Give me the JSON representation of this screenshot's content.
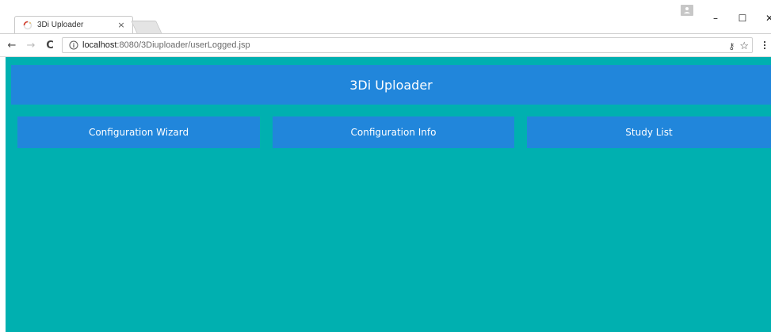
{
  "browser": {
    "tab_title": "3Di Uploader",
    "tab_close": "×",
    "url_host": "localhost",
    "url_path": ":8080/3Diuploader/userLogged.jsp",
    "nav_back": "←",
    "nav_forward": "→",
    "nav_reload": "C",
    "window_minimize": "–",
    "window_maximize": "☐",
    "window_close": "✕",
    "star": "☆",
    "key": "⚷"
  },
  "page": {
    "header_title": "3Di Uploader",
    "nav": [
      {
        "label": "Configuration Wizard"
      },
      {
        "label": "Configuration Info"
      },
      {
        "label": "Study List"
      }
    ]
  },
  "colors": {
    "background": "#00b0b0",
    "accent": "#2186db",
    "text_on_accent": "#ffffff"
  }
}
